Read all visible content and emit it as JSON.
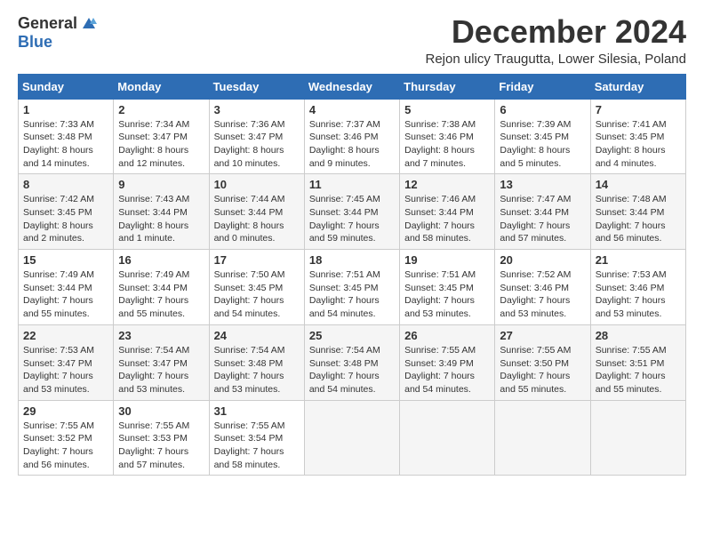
{
  "header": {
    "logo_general": "General",
    "logo_blue": "Blue",
    "title": "December 2024",
    "subtitle": "Rejon ulicy Traugutta, Lower Silesia, Poland"
  },
  "days_of_week": [
    "Sunday",
    "Monday",
    "Tuesday",
    "Wednesday",
    "Thursday",
    "Friday",
    "Saturday"
  ],
  "weeks": [
    [
      {
        "day": 1,
        "sunrise": "7:33 AM",
        "sunset": "3:48 PM",
        "daylight": "8 hours and 14 minutes."
      },
      {
        "day": 2,
        "sunrise": "7:34 AM",
        "sunset": "3:47 PM",
        "daylight": "8 hours and 12 minutes."
      },
      {
        "day": 3,
        "sunrise": "7:36 AM",
        "sunset": "3:47 PM",
        "daylight": "8 hours and 10 minutes."
      },
      {
        "day": 4,
        "sunrise": "7:37 AM",
        "sunset": "3:46 PM",
        "daylight": "8 hours and 9 minutes."
      },
      {
        "day": 5,
        "sunrise": "7:38 AM",
        "sunset": "3:46 PM",
        "daylight": "8 hours and 7 minutes."
      },
      {
        "day": 6,
        "sunrise": "7:39 AM",
        "sunset": "3:45 PM",
        "daylight": "8 hours and 5 minutes."
      },
      {
        "day": 7,
        "sunrise": "7:41 AM",
        "sunset": "3:45 PM",
        "daylight": "8 hours and 4 minutes."
      }
    ],
    [
      {
        "day": 8,
        "sunrise": "7:42 AM",
        "sunset": "3:45 PM",
        "daylight": "8 hours and 2 minutes."
      },
      {
        "day": 9,
        "sunrise": "7:43 AM",
        "sunset": "3:44 PM",
        "daylight": "8 hours and 1 minute."
      },
      {
        "day": 10,
        "sunrise": "7:44 AM",
        "sunset": "3:44 PM",
        "daylight": "8 hours and 0 minutes."
      },
      {
        "day": 11,
        "sunrise": "7:45 AM",
        "sunset": "3:44 PM",
        "daylight": "7 hours and 59 minutes."
      },
      {
        "day": 12,
        "sunrise": "7:46 AM",
        "sunset": "3:44 PM",
        "daylight": "7 hours and 58 minutes."
      },
      {
        "day": 13,
        "sunrise": "7:47 AM",
        "sunset": "3:44 PM",
        "daylight": "7 hours and 57 minutes."
      },
      {
        "day": 14,
        "sunrise": "7:48 AM",
        "sunset": "3:44 PM",
        "daylight": "7 hours and 56 minutes."
      }
    ],
    [
      {
        "day": 15,
        "sunrise": "7:49 AM",
        "sunset": "3:44 PM",
        "daylight": "7 hours and 55 minutes."
      },
      {
        "day": 16,
        "sunrise": "7:49 AM",
        "sunset": "3:44 PM",
        "daylight": "7 hours and 55 minutes."
      },
      {
        "day": 17,
        "sunrise": "7:50 AM",
        "sunset": "3:45 PM",
        "daylight": "7 hours and 54 minutes."
      },
      {
        "day": 18,
        "sunrise": "7:51 AM",
        "sunset": "3:45 PM",
        "daylight": "7 hours and 54 minutes."
      },
      {
        "day": 19,
        "sunrise": "7:51 AM",
        "sunset": "3:45 PM",
        "daylight": "7 hours and 53 minutes."
      },
      {
        "day": 20,
        "sunrise": "7:52 AM",
        "sunset": "3:46 PM",
        "daylight": "7 hours and 53 minutes."
      },
      {
        "day": 21,
        "sunrise": "7:53 AM",
        "sunset": "3:46 PM",
        "daylight": "7 hours and 53 minutes."
      }
    ],
    [
      {
        "day": 22,
        "sunrise": "7:53 AM",
        "sunset": "3:47 PM",
        "daylight": "7 hours and 53 minutes."
      },
      {
        "day": 23,
        "sunrise": "7:54 AM",
        "sunset": "3:47 PM",
        "daylight": "7 hours and 53 minutes."
      },
      {
        "day": 24,
        "sunrise": "7:54 AM",
        "sunset": "3:48 PM",
        "daylight": "7 hours and 53 minutes."
      },
      {
        "day": 25,
        "sunrise": "7:54 AM",
        "sunset": "3:48 PM",
        "daylight": "7 hours and 54 minutes."
      },
      {
        "day": 26,
        "sunrise": "7:55 AM",
        "sunset": "3:49 PM",
        "daylight": "7 hours and 54 minutes."
      },
      {
        "day": 27,
        "sunrise": "7:55 AM",
        "sunset": "3:50 PM",
        "daylight": "7 hours and 55 minutes."
      },
      {
        "day": 28,
        "sunrise": "7:55 AM",
        "sunset": "3:51 PM",
        "daylight": "7 hours and 55 minutes."
      }
    ],
    [
      {
        "day": 29,
        "sunrise": "7:55 AM",
        "sunset": "3:52 PM",
        "daylight": "7 hours and 56 minutes."
      },
      {
        "day": 30,
        "sunrise": "7:55 AM",
        "sunset": "3:53 PM",
        "daylight": "7 hours and 57 minutes."
      },
      {
        "day": 31,
        "sunrise": "7:55 AM",
        "sunset": "3:54 PM",
        "daylight": "7 hours and 58 minutes."
      },
      null,
      null,
      null,
      null
    ]
  ]
}
